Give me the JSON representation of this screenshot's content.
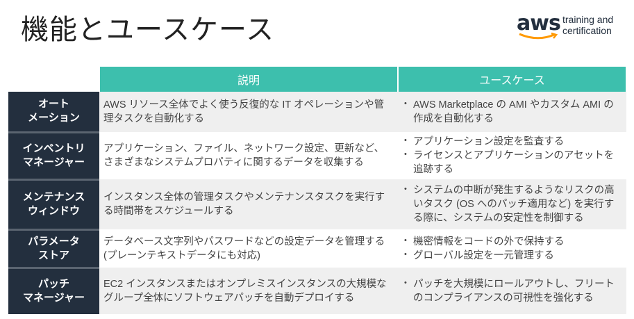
{
  "title": "機能とユースケース",
  "logo": {
    "brand": "aws",
    "line1": "training and",
    "line2": "certification"
  },
  "table": {
    "headers": [
      "説明",
      "ユースケース"
    ],
    "rows": [
      {
        "label": [
          "オート",
          "メーション"
        ],
        "desc": "AWS リソース全体でよく使う反復的な IT オペレーションや管理タスクを自動化する",
        "uses": [
          "AWS Marketplace の AMI やカスタム AMI の作成を自動化する"
        ]
      },
      {
        "label": [
          "インベントリ",
          "マネージャー"
        ],
        "desc": "アプリケーション、ファイル、ネットワーク設定、更新など、さまざまなシステムプロパティに関するデータを収集する",
        "uses": [
          "アプリケーション設定を監査する",
          "ライセンスとアプリケーションのアセットを追跡する"
        ]
      },
      {
        "label": [
          "メンテナンス",
          "ウィンドウ"
        ],
        "desc": "インスタンス全体の管理タスクやメンテナンスタスクを実行する時間帯をスケジュールする",
        "uses": [
          "システムの中断が発生するようなリスクの高いタスク (OS へのパッチ適用など) を実行する際に、システムの安定性を制御する"
        ]
      },
      {
        "label": [
          "パラメータ",
          "ストア"
        ],
        "desc": "データベース文字列やパスワードなどの設定データを管理する (プレーンテキストデータにも対応)",
        "uses": [
          "機密情報をコードの外で保持する",
          "グローバル設定を一元管理する"
        ]
      },
      {
        "label": [
          "パッチ",
          "マネージャー"
        ],
        "desc": "EC2 インスタンスまたはオンプレミスインスタンスの大規模なグループ全体にソフトウェアパッチを自動デプロイする",
        "uses": [
          "パッチを大規模にロールアウトし、フリートのコンプライアンスの可視性を強化する"
        ]
      }
    ]
  },
  "colors": {
    "header": "#3dbfad",
    "label_bg": "#232f3e",
    "row_alt": "#efefef",
    "logo_smile": "#ff9900"
  }
}
